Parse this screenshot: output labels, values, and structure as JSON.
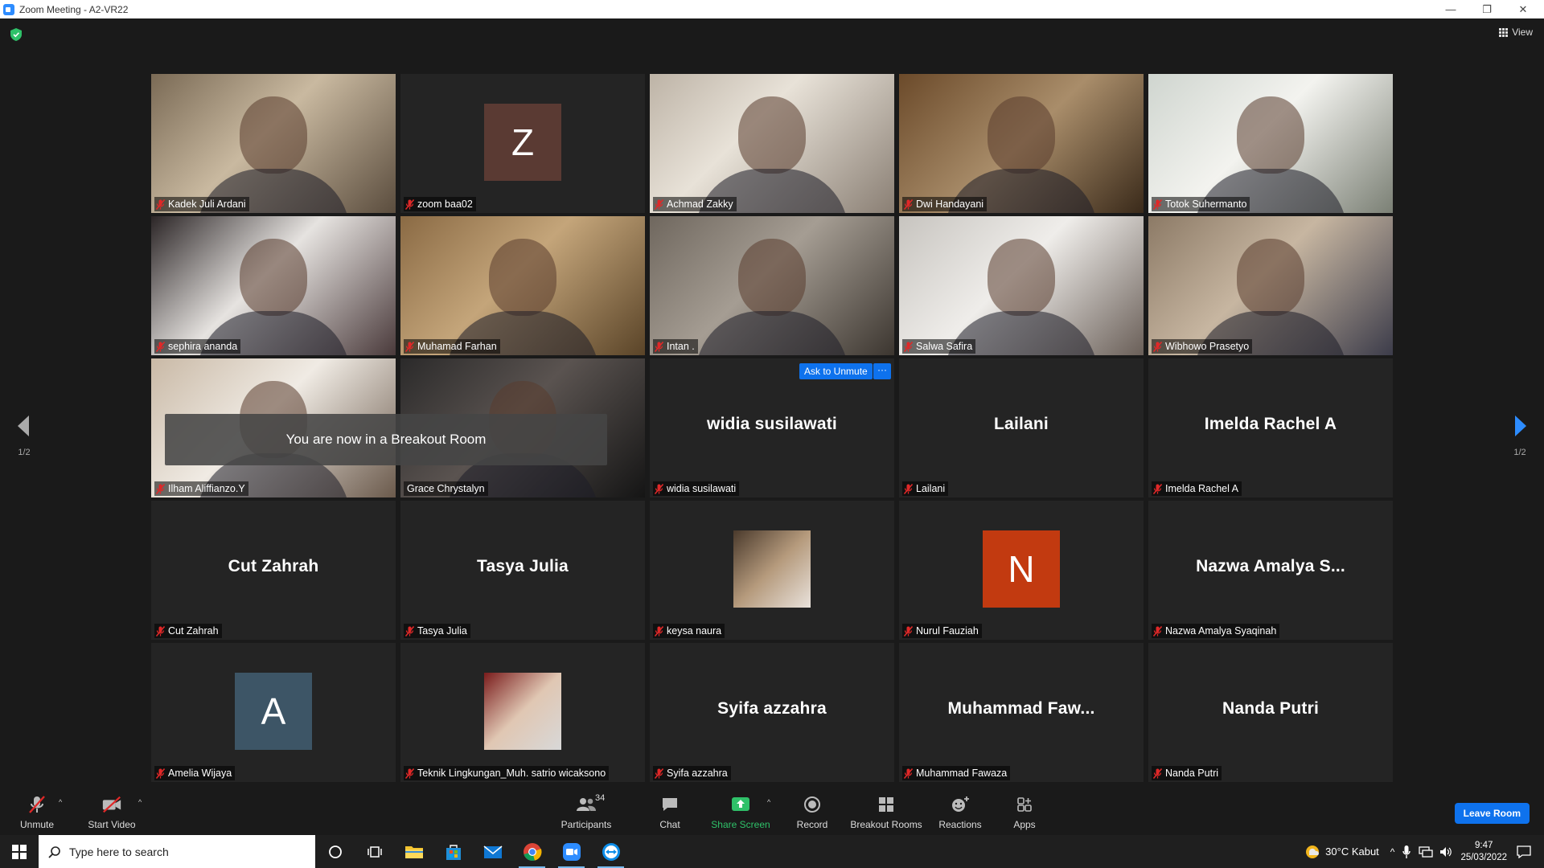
{
  "window": {
    "title": "Zoom Meeting - A2-VR22",
    "minimize": "—",
    "maximize": "❐",
    "close": "✕"
  },
  "meeting": {
    "view_label": "View",
    "breakout_toast": "You are now in a Breakout Room",
    "ask_to_unmute": "Ask to Unmute",
    "more": "···",
    "page_left": "1/2",
    "page_right": "1/2"
  },
  "participants_grid": [
    {
      "name": "Kadek Juli Ardani",
      "kind": "video",
      "muted": true
    },
    {
      "name": "zoom baa02",
      "kind": "letter",
      "letter": "Z",
      "color": "#5a3a33",
      "muted": true
    },
    {
      "name": "Achmad Zakky",
      "kind": "video",
      "muted": true
    },
    {
      "name": "Dwi Handayani",
      "kind": "video",
      "muted": true
    },
    {
      "name": "Totok Suhermanto",
      "kind": "video",
      "muted": true
    },
    {
      "name": "sephira ananda",
      "kind": "video",
      "muted": true
    },
    {
      "name": "Muhamad Farhan",
      "kind": "video",
      "muted": true
    },
    {
      "name": "Intan .",
      "kind": "video",
      "muted": true
    },
    {
      "name": "Salwa Safira",
      "kind": "video",
      "muted": true
    },
    {
      "name": "Wibhowo Prasetyo",
      "kind": "video",
      "muted": true
    },
    {
      "name": "Ilham Aliffianzo.Y",
      "kind": "video",
      "muted": true
    },
    {
      "name": "Grace Chrystalyn",
      "kind": "video",
      "muted": false,
      "active_speaker": true
    },
    {
      "name": "widia susilawati",
      "kind": "name",
      "display": "widia susilawati",
      "muted": true
    },
    {
      "name": "Lailani",
      "kind": "name",
      "display": "Lailani",
      "muted": true
    },
    {
      "name": "Imelda Rachel A",
      "kind": "name",
      "display": "Imelda Rachel A",
      "muted": true
    },
    {
      "name": "Cut Zahrah",
      "kind": "name",
      "display": "Cut Zahrah",
      "muted": true
    },
    {
      "name": "Tasya Julia",
      "kind": "name",
      "display": "Tasya Julia",
      "muted": true
    },
    {
      "name": "keysa naura",
      "kind": "avatar",
      "muted": true
    },
    {
      "name": "Nurul Fauziah",
      "kind": "letter",
      "letter": "N",
      "color": "#c23a10",
      "muted": true
    },
    {
      "name": "Nazwa Amalya Syaqinah",
      "kind": "name",
      "display": "Nazwa Amalya S...",
      "muted": true
    },
    {
      "name": "Amelia Wijaya",
      "kind": "letter",
      "letter": "A",
      "color": "#3d5566",
      "muted": true
    },
    {
      "name": "Teknik Lingkungan_Muh. satrio wicaksono",
      "kind": "avatar",
      "muted": true
    },
    {
      "name": "Syifa azzahra",
      "kind": "name",
      "display": "Syifa azzahra",
      "muted": true
    },
    {
      "name": "Muhammad Fawaza",
      "kind": "name",
      "display": "Muhammad Faw...",
      "muted": true
    },
    {
      "name": "Nanda Putri",
      "kind": "name",
      "display": "Nanda Putri",
      "muted": true
    }
  ],
  "toolbar": {
    "unmute": "Unmute",
    "start_video": "Start Video",
    "participants": "Participants",
    "participants_count": "34",
    "chat": "Chat",
    "share_screen": "Share Screen",
    "record": "Record",
    "breakout_rooms": "Breakout Rooms",
    "reactions": "Reactions",
    "apps": "Apps",
    "leave_room": "Leave Room"
  },
  "taskbar": {
    "search_placeholder": "Type here to search",
    "weather": "30°C  Kabut",
    "time": "9:47",
    "date": "25/03/2022"
  },
  "colors": {
    "accent_blue": "#0e72ed",
    "share_green": "#2fc169",
    "muted_red": "#e02828",
    "active_outline": "#e6e68a"
  }
}
